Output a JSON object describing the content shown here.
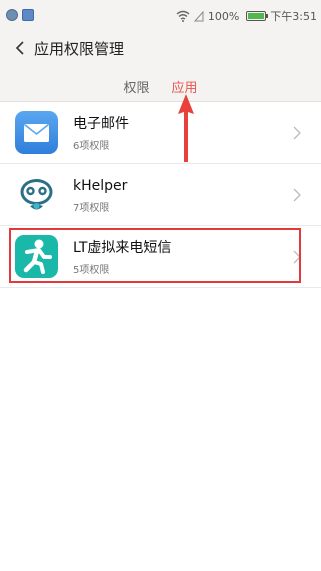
{
  "status_bar": {
    "battery": "100%",
    "time": "下午3:51",
    "battery_level": 1.0
  },
  "header": {
    "title": "应用权限管理",
    "back_icon": "chevron-left-icon"
  },
  "tabs": [
    {
      "label": "权限",
      "active": false
    },
    {
      "label": "应用",
      "active": true
    }
  ],
  "apps": [
    {
      "name": "电子邮件",
      "permissions": "6项权限",
      "icon": "mail-icon"
    },
    {
      "name": "kHelper",
      "permissions": "7项权限",
      "icon": "khelper-icon"
    },
    {
      "name": "LT虚拟来电短信",
      "permissions": "5项权限",
      "icon": "runner-icon"
    }
  ],
  "colors": {
    "accent": "#e8554e",
    "header_bg": "#f5f3f1",
    "highlight": "#e23a3a"
  }
}
